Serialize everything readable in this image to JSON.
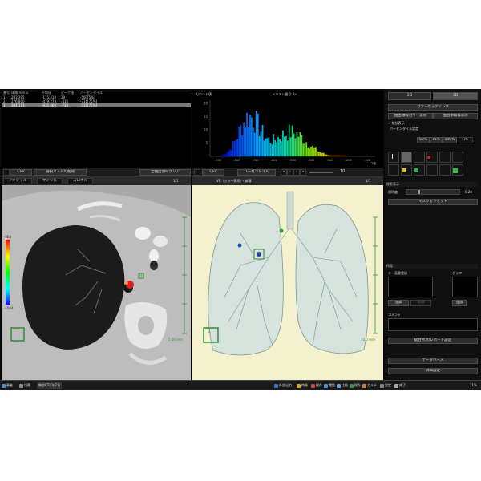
{
  "table": {
    "columns": [
      "番号",
      "体積[mm3]",
      "平均値",
      "ピーク値",
      "パーセンタイル"
    ],
    "rows": [
      [
        "1",
        "283.295",
        "-115.410",
        "29",
        "-56[75%]"
      ],
      [
        "2",
        "276.800",
        "-479.273",
        "-416",
        "-316[75%]"
      ],
      [
        "3",
        "304.113",
        "-632.460",
        "-734",
        "-532[75%]"
      ]
    ],
    "selected_row": 3
  },
  "table_toolbar": {
    "csv": "CSV",
    "select_delete": "選択リストの削除",
    "clear_all": "全抽出領域クリア"
  },
  "histogram": {
    "ylabel": "カウント値",
    "title": "<リスト番号 3>",
    "y_ticks": [
      "20",
      "15",
      "10",
      "5"
    ],
    "x_ticks": [
      "-900",
      "-800",
      "-700",
      "-600",
      "-500",
      "-400",
      "-300",
      "-200",
      "-100"
    ],
    "x_unit": "CT値",
    "toolbar": {
      "csv": "CSV",
      "percentile": "パーセンタイル",
      "value": "10"
    }
  },
  "viewer_a": {
    "tabs": [
      "アキシャル",
      "サジタル",
      "コロナル"
    ],
    "header_right": "1/1",
    "colorbar_top": "-264",
    "colorbar_bottom": "-1004",
    "marker_label": "H",
    "scale": "5.00 mm"
  },
  "viewer_b": {
    "header": "VR（カラー表示）・体積",
    "header_right": "1/1",
    "marker_label": "A",
    "scale": "10.0 mm"
  },
  "right_panel": {
    "btn_2d": "2D",
    "btn_3d": "3D",
    "color_setting": "カラーセッティング",
    "extract_color_display": "抽出領域カラー表示",
    "extract_region_display": "抽出領域枠表示",
    "check_label": "✓ 統計表示",
    "percentile_setting": "パーセンタイル設定",
    "percent_buttons": [
      "50%",
      "75%",
      "100%"
    ],
    "percent_field": "75",
    "opacity_section": "除影表示",
    "opacity_label": "透明度",
    "opacity_value": "0.20",
    "mask_reset": "マスクをリセット",
    "findings_section": "所見",
    "key_image": "キー画像登録",
    "graph": "グラフ",
    "register": "登録",
    "delete": "削除",
    "comment": "コメント",
    "report_setting": "総合所見/レポート設定",
    "database": "データベース",
    "detail_setting": "詳細設定"
  },
  "taskbar": {
    "items": [
      "患者",
      "切替",
      "胸部CT(Op21)",
      "外部出力",
      "特殊",
      "保存",
      "閲覧",
      "比較",
      "保存",
      "カルテ",
      "設定",
      "終了"
    ],
    "right": "21%"
  },
  "colors": {
    "viewer_a_bg": "#b4b4b4",
    "viewer_b_bg": "#f4f1cf",
    "selection_row": "#7a7a7a",
    "marker_green": "#2f8f3a",
    "lesion_red": "#e02020"
  }
}
